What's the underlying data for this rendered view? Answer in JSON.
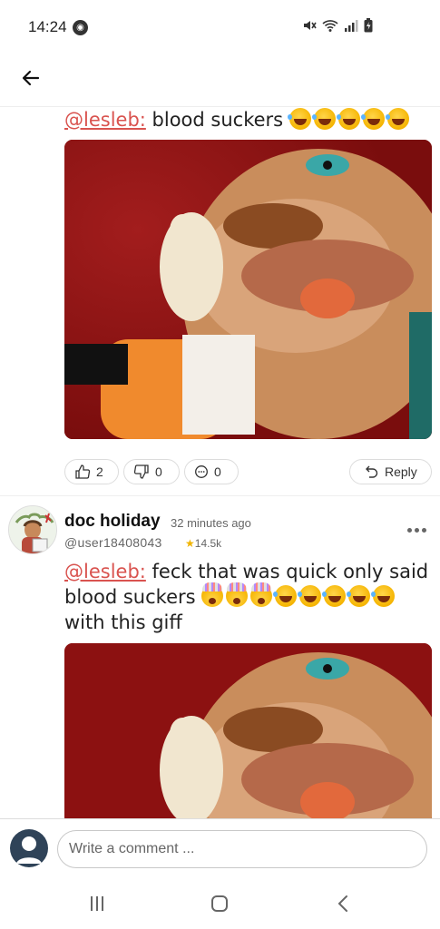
{
  "status_bar": {
    "time": "14:24",
    "icons": [
      "whatsapp-icon",
      "mute-icon",
      "wifi-icon",
      "signal-icon",
      "battery-icon"
    ]
  },
  "top_bar": {
    "back_icon": "arrow-left-icon"
  },
  "comments": [
    {
      "mention": "@lesleb:",
      "text": " blood suckers",
      "emojis": [
        "laugh",
        "laugh",
        "laugh",
        "laugh",
        "laugh"
      ],
      "likes": "2",
      "dislikes": "0",
      "replies": "0",
      "reply_label": "Reply"
    },
    {
      "author": "doc holiday",
      "time_ago": "32 minutes ago",
      "username": "@user18408043",
      "karma": "14.5k",
      "mention": "@lesleb:",
      "text_part1": " feck that was quick only said blood suckers ",
      "emojis": [
        "mind-blown",
        "mind-blown",
        "mind-blown",
        "laugh",
        "laugh",
        "laugh",
        "laugh",
        "laugh"
      ],
      "text_part2": "with this giff"
    }
  ],
  "composer": {
    "placeholder": "Write a comment ..."
  },
  "nav_bar": {
    "icons": [
      "recent-apps-icon",
      "home-icon",
      "back-icon"
    ]
  },
  "colors": {
    "mention": "#d9534f",
    "gif_background": "#8c1111",
    "karma_star": "#f0b400"
  }
}
